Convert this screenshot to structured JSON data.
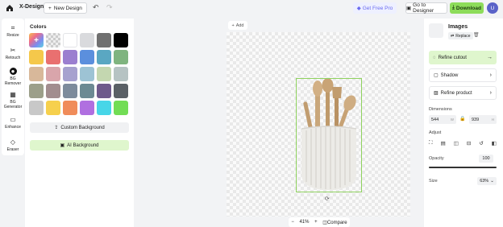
{
  "header": {
    "brand": "X-Design",
    "new_design": "New Design",
    "get_free_pro": "Get Free Pro",
    "go_to_designer": "Go to Designer",
    "download": "Download",
    "avatar_initial": "U"
  },
  "tools": [
    {
      "label": "Resize",
      "icon": "crop-icon"
    },
    {
      "label": "Retouch",
      "icon": "retouch-icon"
    },
    {
      "label": "BG\nRemover",
      "icon": "bg-remover-icon"
    },
    {
      "label": "BG\nGenerator",
      "icon": "bg-generator-icon"
    },
    {
      "label": "Enhance",
      "icon": "enhance-icon"
    },
    {
      "label": "Eraser",
      "icon": "eraser-icon"
    }
  ],
  "colors_panel": {
    "title": "Colors",
    "swatches": [
      "#add",
      "#checker",
      "#ffffff",
      "#d9dadd",
      "#707070",
      "#000000",
      "#f5c84b",
      "#e97070",
      "#9b7fd0",
      "#5b8fdd",
      "#5aa7c2",
      "#7fb47f",
      "#d8b89a",
      "#d9a5ab",
      "#a6a1cf",
      "#9dc3d4",
      "#c4d7b0",
      "#b6c3c3",
      "#9c9f8a",
      "#a28d8f",
      "#7d8b9c",
      "#6c8a93",
      "#6e5a8b",
      "#5a6066",
      "#c8c8c8",
      "#f6d04d",
      "#f08c5a",
      "#b06fe0",
      "#47d6e8",
      "#72dd55"
    ],
    "custom_background": "Custom Background",
    "ai_background": "AI Background"
  },
  "canvas": {
    "add_label": "Add",
    "zoom": "41%",
    "compare": "Compare"
  },
  "right_panel": {
    "title": "Images",
    "replace": "Replace",
    "refine_cutout": "Refine cutout",
    "shadow": "Shadow",
    "refine_product": "Refine product",
    "dimensions_label": "Dimensions",
    "width": "544",
    "width_unit": "W",
    "height": "939",
    "height_unit": "H",
    "adjust_label": "Adjust",
    "opacity_label": "Opacity",
    "opacity_value": "100",
    "opacity_level": 1.0,
    "size_label": "Size",
    "size_value": "63%"
  },
  "colors": {
    "accent_green": "#8ddc5a",
    "accent_green_soft": "#dff6cd",
    "pro_purple": "#6b6bf0"
  }
}
